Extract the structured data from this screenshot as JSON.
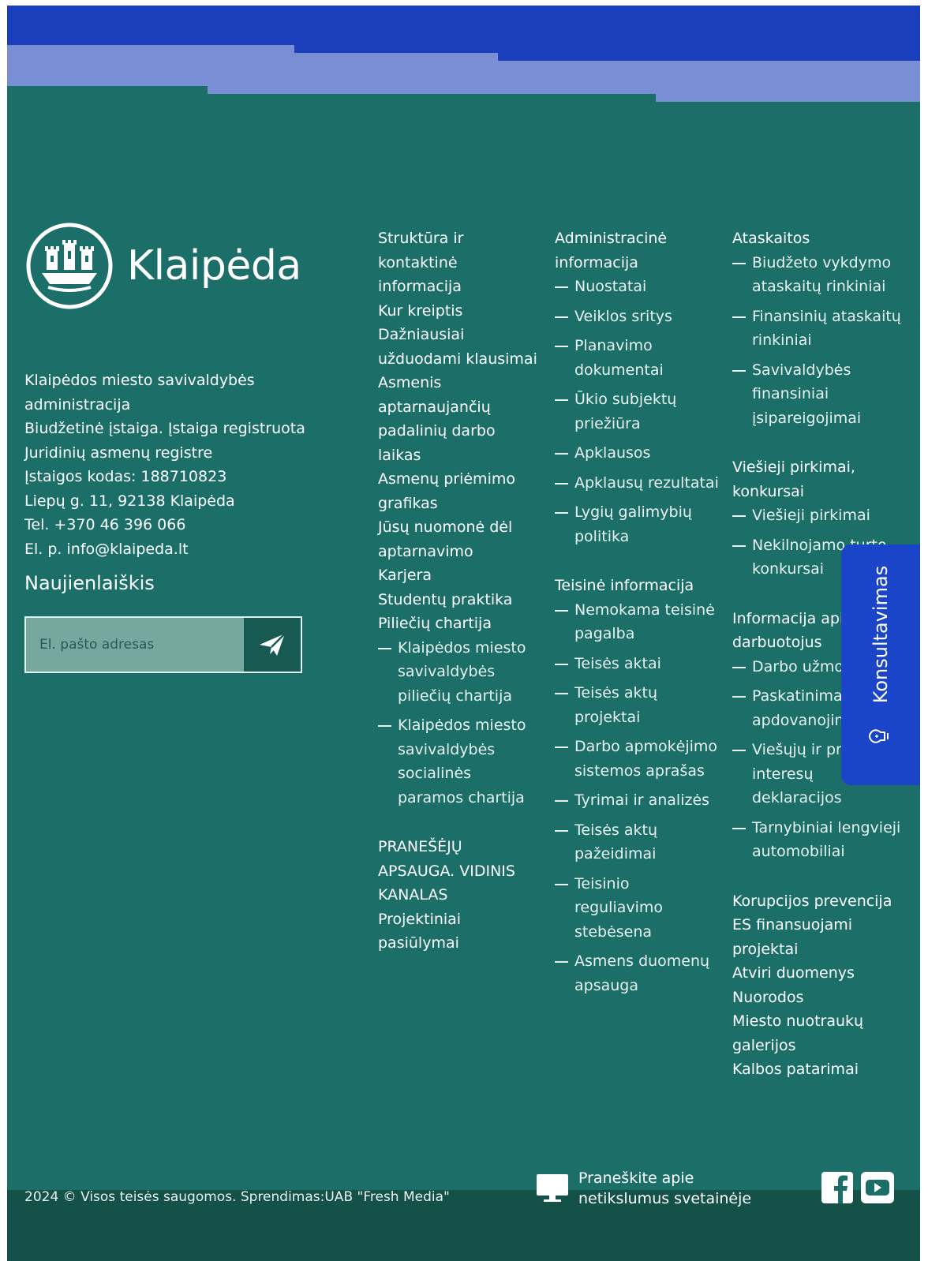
{
  "brand": {
    "name": "Klaipėda"
  },
  "address": {
    "lines": [
      "Klaipėdos miesto savivaldybės",
      "administracija",
      "Biudžetinė įstaiga. Įstaiga registruota",
      "Juridinių asmenų registre",
      "Įstaigos kodas: 188710823",
      "Liepų g. 11, 92138 Klaipėda",
      "Tel. +370 46 396 066",
      "El. p. info@klaipeda.lt"
    ]
  },
  "newsletter": {
    "title": "Naujienlaiškis",
    "placeholder": "El. pašto adresas"
  },
  "col1": {
    "items": [
      "Struktūra ir kontaktinė informacija",
      "Kur kreiptis",
      "Dažniausiai užduodami klausimai",
      "Asmenis aptarnaujančių padalinių darbo laikas",
      "Asmenų priėmimo grafikas",
      "Jūsų nuomonė dėl aptarnavimo",
      "Karjera",
      "Studentų praktika",
      "Piliečių chartija"
    ],
    "sub": [
      "Klaipėdos miesto savivaldybės piliečių chartija",
      "Klaipėdos miesto savivaldybės socialinės paramos chartija"
    ],
    "after": [
      "PRANEŠĖJŲ APSAUGA. VIDINIS KANALAS",
      "Projektiniai pasiūlymai"
    ]
  },
  "col2": {
    "admin_head": "Administracinė informacija",
    "admin_sub": [
      "Nuostatai",
      "Veiklos sritys",
      "Planavimo dokumentai",
      "Ūkio subjektų priežiūra",
      "Apklausos",
      "Apklausų rezultatai",
      "Lygių galimybių politika"
    ],
    "legal_head": "Teisinė informacija",
    "legal_sub": [
      "Nemokama teisinė pagalba",
      "Teisės aktai",
      "Teisės aktų projektai",
      "Darbo apmokėjimo sistemos aprašas",
      "Tyrimai ir analizės",
      "Teisės aktų pažeidimai",
      "Teisinio reguliavimo stebėsena",
      "Asmens duomenų apsauga"
    ]
  },
  "col3": {
    "reports_head": "Ataskaitos",
    "reports_sub": [
      "Biudžeto vykdymo ataskaitų rinkiniai",
      "Finansinių ataskaitų rinkiniai",
      "Savivaldybės finansiniai įsipareigojimai"
    ],
    "procure_head": "Viešieji pirkimai, konkursai",
    "procure_sub": [
      "Viešieji pirkimai",
      "Nekilnojamo turto konkursai"
    ],
    "staff_head": "Informacija apie darbuotojus",
    "staff_sub": [
      "Darbo užmokestis",
      "Paskatinimai ir apdovanojimai",
      "Viešųjų ir privačių interesų deklaracijos",
      "Tarnybiniai lengvieji automobiliai"
    ],
    "links": [
      "Korupcijos prevencija",
      "ES finansuojami projektai",
      "Atviri duomenys",
      "Nuorodos",
      "Miesto nuotraukų galerijos",
      "Kalbos patarimai"
    ]
  },
  "consult": {
    "label": "Konsultavimas"
  },
  "footer": {
    "copyright": "2024 © Visos teisės saugomos. Sprendimas:UAB \"Fresh Media\"",
    "report": "Praneškite apie netikslumus svetainėje"
  },
  "colors": {
    "background": "#1c6f68",
    "band": "#1b3fbc",
    "band_light": "#7a8ed6",
    "consult": "#1b45c8",
    "bottom": "#135149"
  }
}
